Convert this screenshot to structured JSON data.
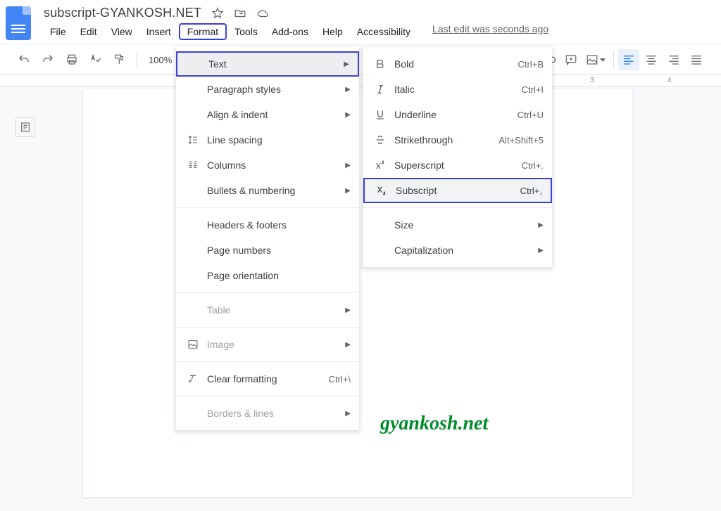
{
  "doc_title": "subscript-GYANKOSH.NET",
  "menubar": {
    "file": "File",
    "edit": "Edit",
    "view": "View",
    "insert": "Insert",
    "format": "Format",
    "tools": "Tools",
    "addons": "Add-ons",
    "help": "Help",
    "accessibility": "Accessibility"
  },
  "last_edit": "Last edit was seconds ago",
  "toolbar": {
    "zoom": "100%"
  },
  "ruler": {
    "mark3": "3",
    "mark4": "4"
  },
  "format_menu": {
    "text": "Text",
    "paragraph_styles": "Paragraph styles",
    "align_indent": "Align & indent",
    "line_spacing": "Line spacing",
    "columns": "Columns",
    "bullets_numbering": "Bullets & numbering",
    "headers_footers": "Headers & footers",
    "page_numbers": "Page numbers",
    "page_orientation": "Page orientation",
    "table": "Table",
    "image": "Image",
    "clear_formatting": "Clear formatting",
    "clear_formatting_shortcut": "Ctrl+\\",
    "borders_lines": "Borders & lines"
  },
  "text_menu": {
    "bold": "Bold",
    "bold_shortcut": "Ctrl+B",
    "italic": "Italic",
    "italic_shortcut": "Ctrl+I",
    "underline": "Underline",
    "underline_shortcut": "Ctrl+U",
    "strikethrough": "Strikethrough",
    "strikethrough_shortcut": "Alt+Shift+5",
    "superscript": "Superscript",
    "superscript_shortcut": "Ctrl+.",
    "subscript": "Subscript",
    "subscript_shortcut": "Ctrl+,",
    "size": "Size",
    "capitalization": "Capitalization"
  },
  "watermark": "gyankosh.net"
}
